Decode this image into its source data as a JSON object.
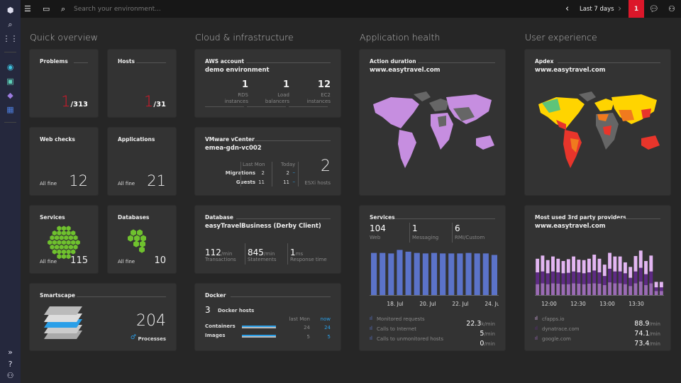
{
  "topbar": {
    "search_placeholder": "Search your environment...",
    "timeframe": "Last 7 days",
    "problems_badge": "1"
  },
  "sections": {
    "quick": "Quick overview",
    "cloud": "Cloud & infrastructure",
    "app": "Application health",
    "ux": "User experience"
  },
  "quick": {
    "problems": {
      "title": "Problems",
      "value": "1",
      "total": "/313"
    },
    "hosts": {
      "title": "Hosts",
      "value": "1",
      "total": "/31"
    },
    "web_checks": {
      "title": "Web checks",
      "status": "All fine",
      "value": "12"
    },
    "applications": {
      "title": "Applications",
      "status": "All fine",
      "value": "21"
    },
    "services": {
      "title": "Services",
      "status": "All fine",
      "value": "115"
    },
    "databases": {
      "title": "Databases",
      "status": "All fine",
      "value": "10"
    },
    "smartscape": {
      "title": "Smartscape",
      "value": "204",
      "label": "Processes"
    }
  },
  "cloud": {
    "aws": {
      "title": "AWS account",
      "name": "demo environment",
      "stats": [
        {
          "value": "1",
          "l1": "RDS",
          "l2": "instances"
        },
        {
          "value": "1",
          "l1": "Load",
          "l2": "balancers"
        },
        {
          "value": "12",
          "l1": "EC2",
          "l2": "instances"
        }
      ]
    },
    "vmware": {
      "title": "VMware vCenter",
      "name": "emea-gdn-vc002",
      "col_last": "Last Mon",
      "col_today": "Today",
      "rows": [
        {
          "label": "Migrations",
          "last": "2",
          "today": "2"
        },
        {
          "label": "Guests",
          "last": "11",
          "today": "11"
        }
      ],
      "trend": "–",
      "esx_value": "2",
      "esx_label": "ESXi hosts"
    },
    "database": {
      "title": "Database",
      "name": "easyTravelBusiness (Derby Client)",
      "stats": [
        {
          "value": "112",
          "unit": "/min",
          "label": "Transactions"
        },
        {
          "value": "845",
          "unit": "/min",
          "label": "Statements"
        },
        {
          "value": "1",
          "unit": "ms",
          "label": "Response time"
        }
      ]
    },
    "docker": {
      "title": "Docker",
      "hosts_value": "3",
      "hosts_label": "Docker hosts",
      "col_last": "last Mon",
      "col_now": "now",
      "rows": [
        {
          "label": "Containers",
          "last": "24",
          "now": "24"
        },
        {
          "label": "Images",
          "last": "5",
          "now": "5"
        }
      ]
    }
  },
  "app": {
    "action": {
      "title": "Action duration",
      "site": "www.easytravel.com"
    },
    "services": {
      "title": "Services",
      "stats": [
        {
          "value": "104",
          "label": "Web"
        },
        {
          "value": "1",
          "label": "Messaging"
        },
        {
          "value": "6",
          "label": "RMI/Custom"
        }
      ],
      "metrics": [
        {
          "label": "Monitored requests",
          "value": "22.3",
          "unit": "k/min"
        },
        {
          "label": "Calls to Internet",
          "value": "5",
          "unit": "/min"
        },
        {
          "label": "Calls to unmonitored hosts",
          "value": "0",
          "unit": "/min"
        }
      ]
    }
  },
  "ux": {
    "apdex": {
      "title": "Apdex",
      "site": "www.easytravel.com"
    },
    "providers": {
      "title": "Most used 3rd party providers",
      "site": "www.easytravel.com",
      "metrics": [
        {
          "label": "cfapps.io",
          "value": "88.9",
          "unit": "/min"
        },
        {
          "label": "dynatrace.com",
          "value": "74.1",
          "unit": "/min"
        },
        {
          "label": "google.com",
          "value": "73.4",
          "unit": "/min"
        }
      ]
    }
  },
  "chart_data": [
    {
      "type": "bar",
      "name": "services",
      "x_ticks": [
        "18. Jul",
        "20. Jul",
        "22. Jul",
        "24. Jul"
      ],
      "values": [
        167,
        167,
        165,
        179,
        172,
        167,
        165,
        167,
        165,
        165,
        165,
        167,
        165,
        165,
        159
      ],
      "color": "#5b73c9"
    },
    {
      "type": "bar",
      "stacked": true,
      "x_ticks": [
        "12:00",
        "12:30",
        "13:00",
        "13:30"
      ],
      "series": [
        {
          "name": "google.com",
          "color": "#9b6bb5",
          "values": [
            48,
            52,
            48,
            52,
            50,
            48,
            48,
            52,
            50,
            48,
            50,
            52,
            50,
            44,
            56,
            52,
            52,
            48,
            40,
            52,
            60,
            44,
            52,
            18,
            18
          ]
        },
        {
          "name": "dynatrace.com",
          "color": "#5e2a84",
          "values": [
            52,
            52,
            48,
            52,
            50,
            48,
            50,
            52,
            50,
            48,
            50,
            56,
            50,
            40,
            60,
            52,
            52,
            48,
            36,
            52,
            60,
            48,
            52,
            16,
            16
          ]
        },
        {
          "name": "cfapps.io",
          "color": "#e3b6f2",
          "values": [
            60,
            70,
            58,
            66,
            60,
            54,
            60,
            66,
            56,
            58,
            60,
            70,
            60,
            50,
            70,
            66,
            66,
            48,
            48,
            68,
            76,
            58,
            70,
            24,
            24
          ]
        }
      ]
    }
  ]
}
